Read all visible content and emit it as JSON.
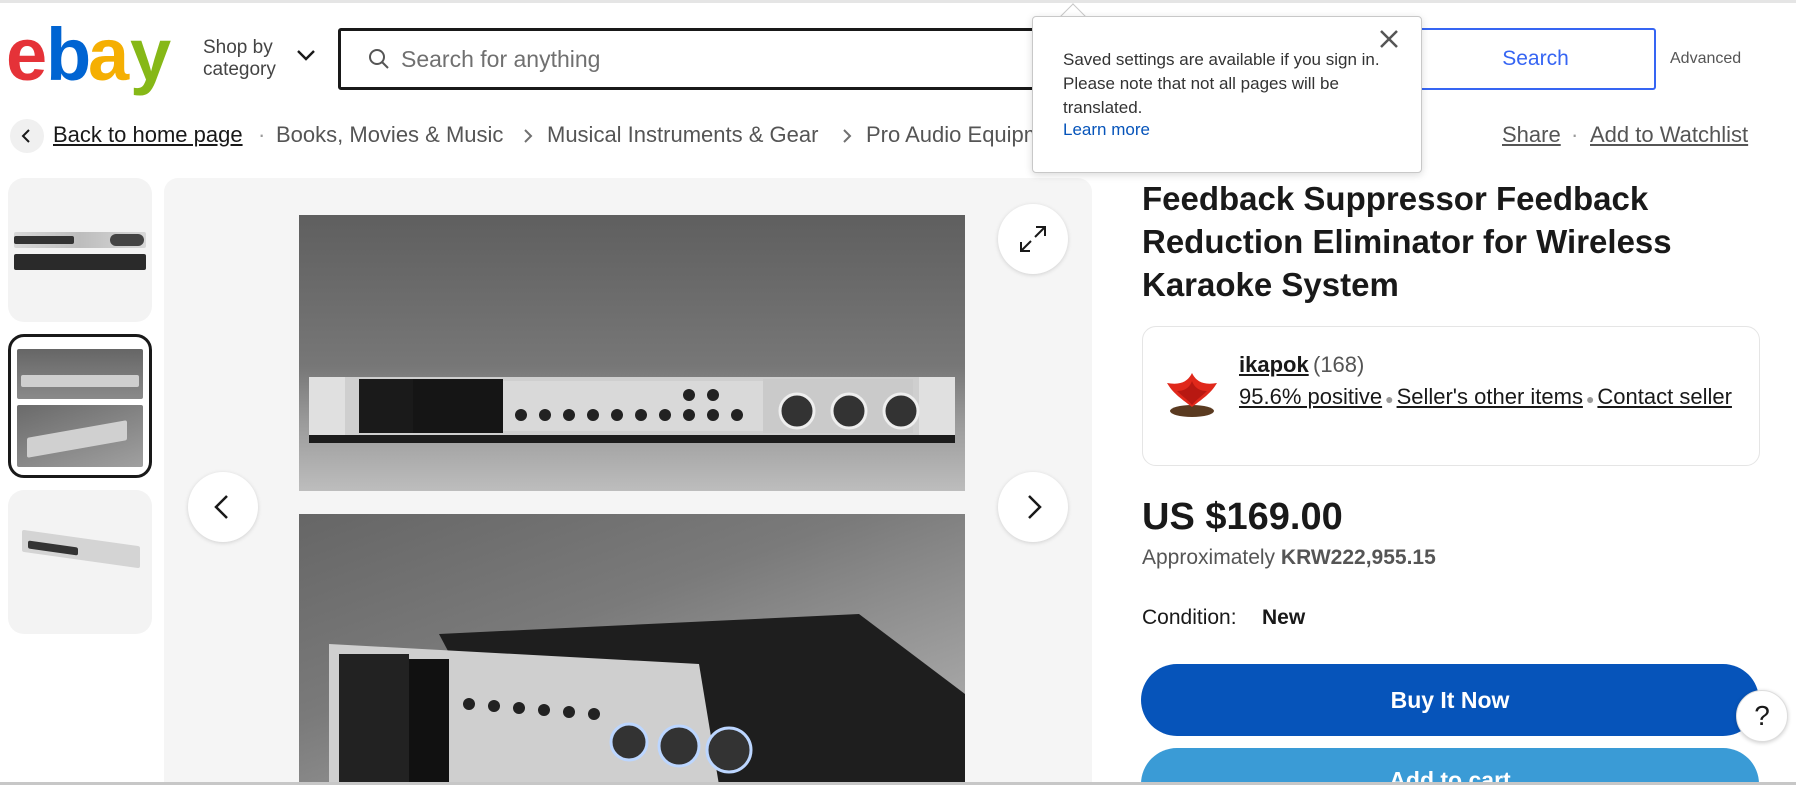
{
  "header": {
    "logo_letters": [
      "e",
      "b",
      "a",
      "y"
    ],
    "logo_colors": [
      "#e53238",
      "#0064d2",
      "#f5af02",
      "#86b817"
    ],
    "shop_by_category_line1": "Shop by",
    "shop_by_category_line2": "category",
    "search_placeholder": "Search for anything",
    "search_button": "Search",
    "advanced": "Advanced"
  },
  "tooltip": {
    "text": "Saved settings are available if you sign in. Please note that not all pages will be translated.",
    "link": "Learn more",
    "close_icon": "close-icon"
  },
  "breadcrumb": {
    "back": "Back to home page",
    "items": [
      "Books, Movies & Music",
      "Musical Instruments & Gear",
      "Pro Audio Equipm"
    ],
    "share": "Share",
    "watchlist": "Add to Watchlist"
  },
  "gallery": {
    "thumbnail_count": 3,
    "selected_thumbnail": 2
  },
  "item": {
    "title": "Feedback Suppressor Feedback Reduction Eliminator for Wireless Karaoke System",
    "seller_name": "ikapok",
    "seller_feedback_count": "(168)",
    "seller_positive": "95.6% positive",
    "seller_other_items": "Seller's other items",
    "contact_seller": "Contact seller",
    "price": "US $169.00",
    "approx_label": "Approximately",
    "approx_value": "KRW222,955.15",
    "condition_label": "Condition:",
    "condition_value": "New",
    "buy_now": "Buy It Now",
    "add_to_cart": "Add to cart"
  },
  "help": "?"
}
